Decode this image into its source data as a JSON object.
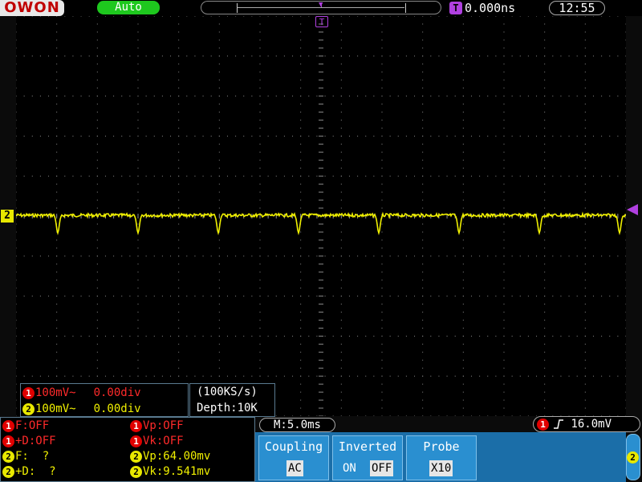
{
  "brand": {
    "logo": "OWON"
  },
  "header": {
    "mode": "Auto",
    "trigger_position": "0.000ns",
    "time": "12:55",
    "trigger_icon": "T"
  },
  "markers": {
    "trigger_marker": "T",
    "channel_marker": "2"
  },
  "channels": [
    {
      "badge": "1",
      "scale": "100mV~",
      "offset": "0.00div",
      "color": "#ff2a2a"
    },
    {
      "badge": "2",
      "scale": "100mV~",
      "offset": "0.00div",
      "color": "#f0f000"
    }
  ],
  "acquisition": {
    "sample_rate": "(100KS/s)",
    "depth": "Depth:10K"
  },
  "measurements": {
    "left": [
      {
        "badge": "1",
        "text": "F:OFF"
      },
      {
        "badge": "1",
        "text": "+D:OFF"
      },
      {
        "badge": "2",
        "text": "F:  ?"
      },
      {
        "badge": "2",
        "text": "+D:  ?"
      }
    ],
    "right": [
      {
        "badge": "1",
        "text": "Vp:OFF"
      },
      {
        "badge": "1",
        "text": "Vk:OFF"
      },
      {
        "badge": "2",
        "text": "Vp:64.00mv"
      },
      {
        "badge": "2",
        "text": "Vk:9.541mv"
      }
    ]
  },
  "timebase": "M:5.0ms",
  "trigger": {
    "badge": "1",
    "edge_icon": "rising-edge-icon",
    "level": "16.0mV"
  },
  "menu": {
    "coupling": {
      "title": "Coupling",
      "value": "AC"
    },
    "inverted": {
      "title": "Inverted",
      "on": "ON",
      "off": "OFF"
    },
    "probe": {
      "title": "Probe",
      "value": "X10"
    },
    "channel": "2"
  },
  "colors": {
    "trace": "#f0f000",
    "grid": "#8a8a8a",
    "trigger": "#b040e0",
    "menu": "#1b6ea8"
  }
}
